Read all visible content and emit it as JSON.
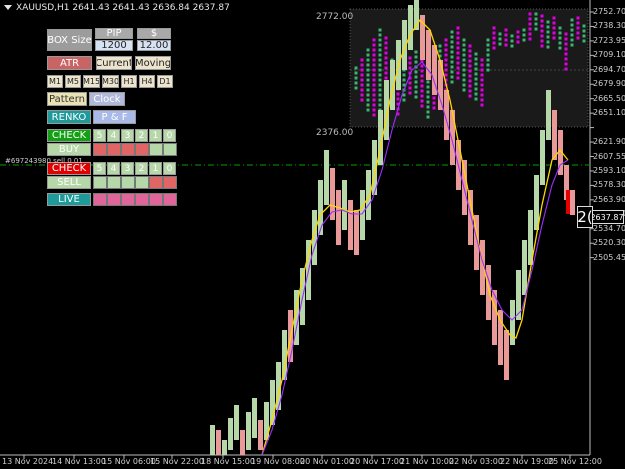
{
  "header": {
    "symbol_info": "XAUUSD,H1  2641.43 2641.43 2636.84 2637.87"
  },
  "colors": {
    "up": "#b6d7a8",
    "down": "#ea9999",
    "signal_line": "#00a000",
    "ma_fast": "#ffd700",
    "ma_slow": "#9b30ff",
    "grid_green": "#3cb371",
    "grid_magenta": "#e000e0"
  },
  "panel": {
    "box_size_label": "BOX Size",
    "pip_label": "PIP",
    "dollar_label": "$",
    "pip_value": "1200",
    "dollar_value": "12.00",
    "atr_label": "ATR",
    "current_label": "Current",
    "moving_label": "Moving",
    "timeframes": [
      "M1",
      "M5",
      "M15",
      "M30",
      "H1",
      "H4",
      "D1"
    ],
    "pattern_label": "Pattern",
    "clock_label": "Clock",
    "renko_label": "RENKO",
    "pf_label": "P & F",
    "check_label": "CHECK",
    "buy_label": "BUY",
    "sell_label": "SELL",
    "live_label": "LIVE",
    "counters": [
      "5",
      "4",
      "3",
      "2",
      "1",
      "0"
    ]
  },
  "order_label": "#697243980 sell 0.01",
  "pf_box": {
    "top_label": "2772.00",
    "bottom_label": "2376.00"
  },
  "current_price": "2637.87",
  "price_cutoff_glyph": "2(",
  "y_axis": [
    "2752.70",
    "2738.30",
    "2723.95",
    "2709.10",
    "2694.70",
    "2679.90",
    "2665.50",
    "2651.10",
    "2637.87",
    "2621.90",
    "2607.55",
    "2593.10",
    "2578.30",
    "2563.90",
    "2549.10",
    "2534.70",
    "2520.30",
    "2505.45"
  ],
  "x_axis": [
    "13 Nov 2024",
    "14 Nov 13:00",
    "15 Nov 06:00",
    "15 Nov 22:00",
    "18 Nov 15:00",
    "19 Nov 08:00",
    "20 Nov 01:00",
    "20 Nov 17:00",
    "21 Nov 10:00",
    "22 Nov 03:00",
    "22 Nov 19:00",
    "25 Nov 12:00"
  ]
}
